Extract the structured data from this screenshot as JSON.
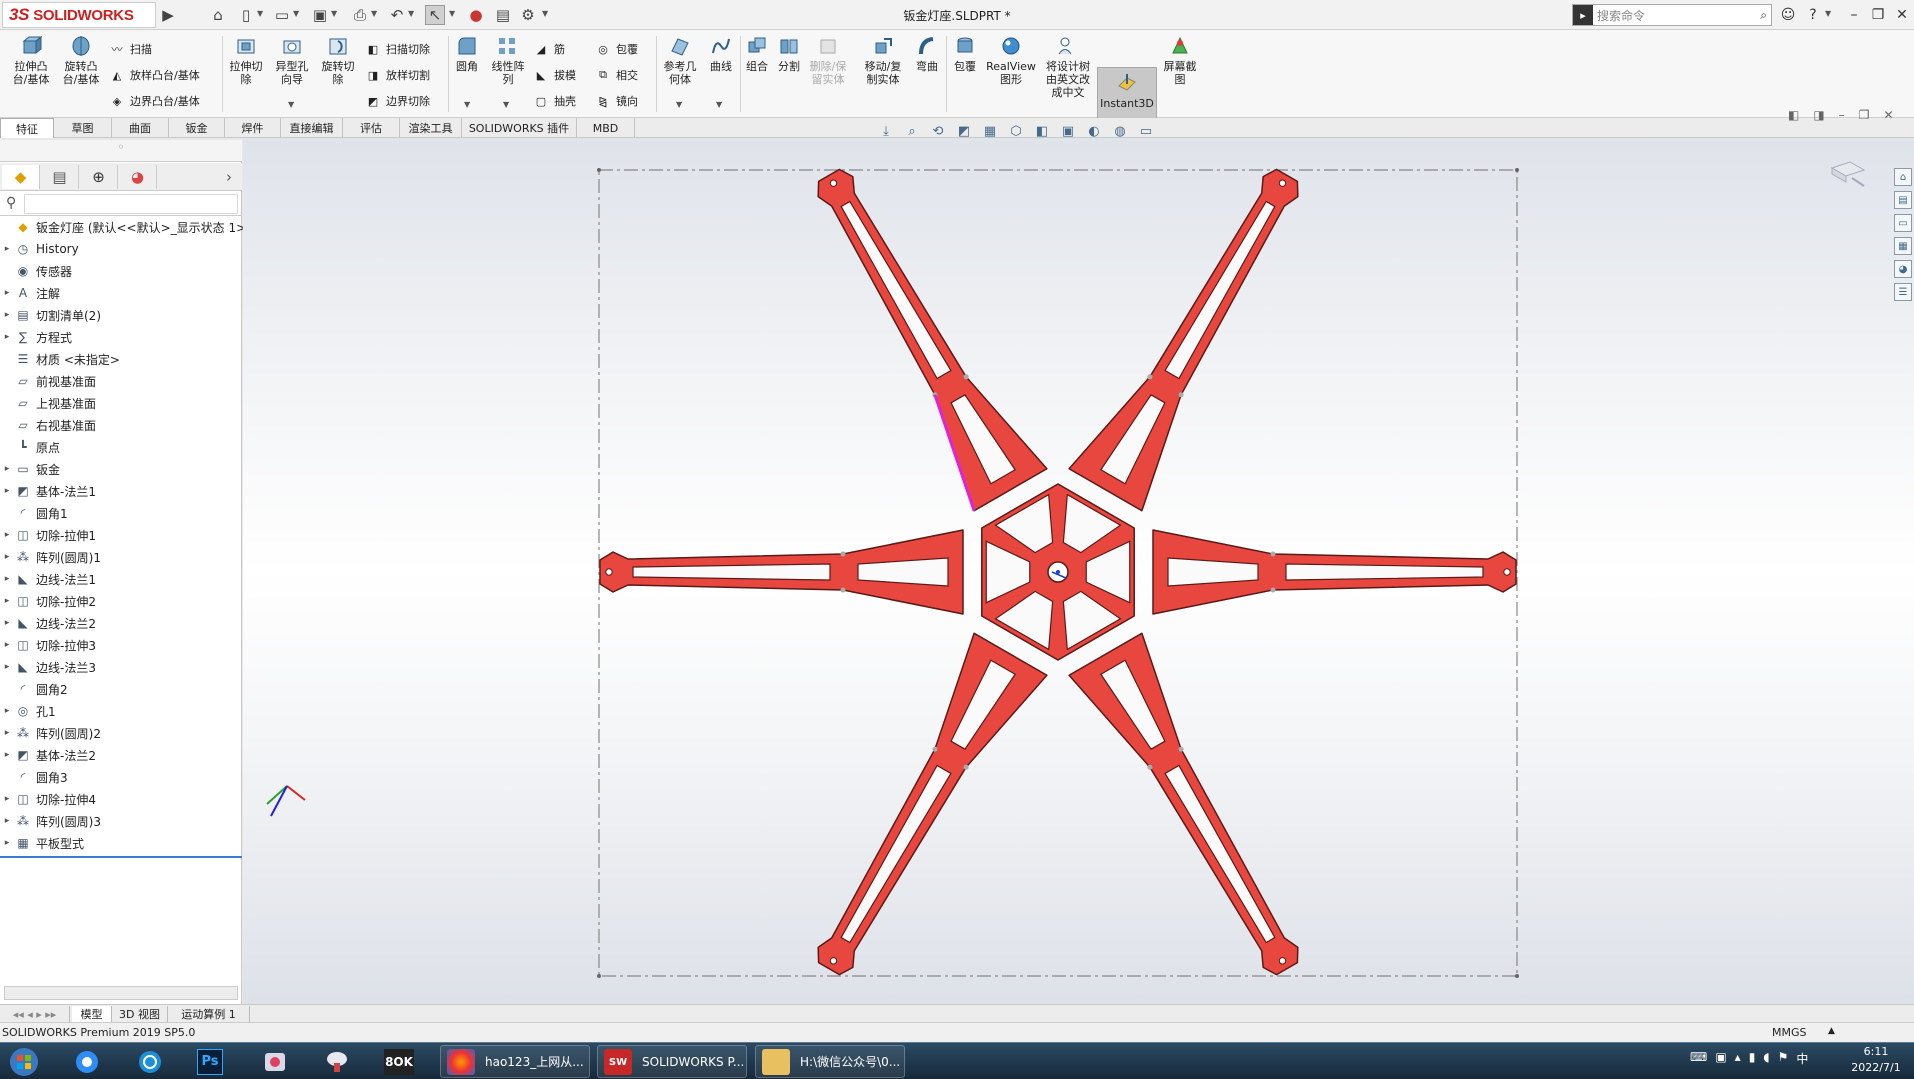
{
  "app": {
    "logo": "SOLIDWORKS",
    "logo_mark": "3S",
    "document_title": "钣金灯座.SLDPRT *",
    "search_placeholder": "搜索命令"
  },
  "quick_access": {
    "icons": [
      "home-icon",
      "new-icon",
      "open-icon",
      "save-icon",
      "print-icon",
      "undo-icon",
      "select-icon",
      "traffic-light-icon",
      "file-props-icon",
      "settings-icon"
    ]
  },
  "ribbon": {
    "extrude_boss": "拉伸凸\n台/基体",
    "revolve_boss": "旋转凸\n台/基体",
    "sweep": "扫描",
    "loft_boss": "放样凸台/基体",
    "boundary_boss": "边界凸台/基体",
    "extrude_cut": "拉伸切\n除",
    "hole_wizard": "异型孔\n向导",
    "revolve_cut": "旋转切\n除",
    "swept_cut": "扫描切除",
    "lofted_cut": "放样切割",
    "boundary_cut": "边界切除",
    "fillet": "圆角",
    "linear_pattern": "线性阵\n列",
    "rib": "筋",
    "draft": "拔模",
    "shell": "抽壳",
    "wrap": "包覆",
    "intersect": "相交",
    "mirror": "镜向",
    "ref_geometry": "参考几\n何体",
    "curves": "曲线",
    "combine": "组合",
    "split": "分割",
    "delete_keep": "删除/保\n留实体",
    "move_copy": "移动/复\n制实体",
    "flex": "弯曲",
    "wrap2": "包覆",
    "realview": "RealView\n图形",
    "translate": "将设计树\n由英文改\n成中文",
    "instant3d": "Instant3D",
    "screenshot": "屏幕截\n图"
  },
  "tabs": [
    "特征",
    "草图",
    "曲面",
    "钣金",
    "焊件",
    "直接编辑",
    "评估",
    "渲染工具",
    "SOLIDWORKS 插件",
    "MBD"
  ],
  "active_tab": "特征",
  "tree": {
    "root": "钣金灯座  (默认<<默认>_显示状态 1>)",
    "items": [
      {
        "label": "History",
        "icon": "history-icon",
        "expand": true
      },
      {
        "label": "传感器",
        "icon": "sensor-icon",
        "expand": false
      },
      {
        "label": "注解",
        "icon": "annotation-icon",
        "expand": true
      },
      {
        "label": "切割清单(2)",
        "icon": "cut-list-icon",
        "expand": true
      },
      {
        "label": "方程式",
        "icon": "equation-icon",
        "expand": true
      },
      {
        "label": "材质 <未指定>",
        "icon": "material-icon",
        "expand": false
      },
      {
        "label": "前视基准面",
        "icon": "plane-icon",
        "expand": false
      },
      {
        "label": "上视基准面",
        "icon": "plane-icon",
        "expand": false
      },
      {
        "label": "右视基准面",
        "icon": "plane-icon",
        "expand": false
      },
      {
        "label": "原点",
        "icon": "origin-icon",
        "expand": false
      },
      {
        "label": "钣金",
        "icon": "sheet-metal-icon",
        "expand": true
      },
      {
        "label": "基体-法兰1",
        "icon": "base-flange-icon",
        "expand": true
      },
      {
        "label": "圆角1",
        "icon": "fillet-icon",
        "expand": false
      },
      {
        "label": "切除-拉伸1",
        "icon": "cut-extrude-icon",
        "expand": true
      },
      {
        "label": "阵列(圆周)1",
        "icon": "circular-pattern-icon",
        "expand": true
      },
      {
        "label": "边线-法兰1",
        "icon": "edge-flange-icon",
        "expand": true
      },
      {
        "label": "切除-拉伸2",
        "icon": "cut-extrude-icon",
        "expand": true
      },
      {
        "label": "边线-法兰2",
        "icon": "edge-flange-icon",
        "expand": true
      },
      {
        "label": "切除-拉伸3",
        "icon": "cut-extrude-icon",
        "expand": true
      },
      {
        "label": "边线-法兰3",
        "icon": "edge-flange-icon",
        "expand": true
      },
      {
        "label": "圆角2",
        "icon": "fillet-icon",
        "expand": false
      },
      {
        "label": "孔1",
        "icon": "hole-icon",
        "expand": true
      },
      {
        "label": "阵列(圆周)2",
        "icon": "circular-pattern-icon",
        "expand": true
      },
      {
        "label": "基体-法兰2",
        "icon": "base-flange-icon",
        "expand": true
      },
      {
        "label": "圆角3",
        "icon": "fillet-icon",
        "expand": false
      },
      {
        "label": "切除-拉伸4",
        "icon": "cut-extrude-icon",
        "expand": true
      },
      {
        "label": "阵列(圆周)3",
        "icon": "circular-pattern-icon",
        "expand": true
      },
      {
        "label": "平板型式",
        "icon": "flat-pattern-icon",
        "expand": true
      }
    ]
  },
  "bottom_tabs": [
    "模型",
    "3D 视图",
    "运动算例 1"
  ],
  "status": {
    "product": "SOLIDWORKS Premium 2019 SP5.0",
    "units": "MMGS"
  },
  "taskbar": {
    "tasks": [
      {
        "label": "hao123_上网从..."
      },
      {
        "label": "SOLIDWORKS P..."
      },
      {
        "label": "H:\\微信公众号\\0..."
      }
    ],
    "time": "6:11",
    "date": "2022/7/1"
  },
  "colors": {
    "part": "#e8473f",
    "part_edge": "#5a1a17",
    "highlight": "#e020e0",
    "accent": "#d01f1f"
  }
}
